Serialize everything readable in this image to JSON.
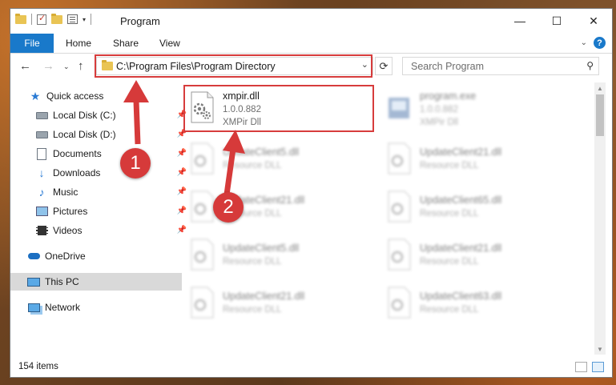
{
  "window": {
    "title": "Program",
    "minimize": "—",
    "maximize": "☐",
    "close": "✕"
  },
  "ribbon": {
    "tabs": [
      "File",
      "Home",
      "Share",
      "View"
    ],
    "help": "?"
  },
  "navbar": {
    "address": "C:\\Program Files\\Program Directory",
    "search_placeholder": "Search Program"
  },
  "sidebar": {
    "items": [
      {
        "label": "Quick access",
        "icon": "star-icon"
      },
      {
        "label": "Local Disk (C:)",
        "icon": "drive-icon"
      },
      {
        "label": "Local Disk (D:)",
        "icon": "drive-icon"
      },
      {
        "label": "Documents",
        "icon": "documents-icon"
      },
      {
        "label": "Downloads",
        "icon": "download-icon"
      },
      {
        "label": "Music",
        "icon": "music-icon"
      },
      {
        "label": "Pictures",
        "icon": "pictures-icon"
      },
      {
        "label": "Videos",
        "icon": "videos-icon"
      },
      {
        "label": "OneDrive",
        "icon": "cloud-icon"
      },
      {
        "label": "This PC",
        "icon": "computer-icon"
      },
      {
        "label": "Network",
        "icon": "network-icon"
      }
    ]
  },
  "files": [
    {
      "name": "xmpir.dll",
      "version": "1.0.0.882",
      "description": "XMPir Dll"
    },
    {
      "name": "program.exe",
      "version": "1.0.0.882",
      "description": "XMPir Dll"
    },
    {
      "name": "UpdateClient5.dll",
      "version": "",
      "description": "Resource DLL"
    },
    {
      "name": "UpdateClient21.dll",
      "version": "",
      "description": "Resource DLL"
    },
    {
      "name": "UpdateClient21.dll",
      "version": "",
      "description": "Resource DLL"
    },
    {
      "name": "UpdateClient65.dll",
      "version": "",
      "description": "Resource DLL"
    },
    {
      "name": "UpdateClient5.dll",
      "version": "",
      "description": "Resource DLL"
    },
    {
      "name": "UpdateClient21.dll",
      "version": "",
      "description": "Resource DLL"
    },
    {
      "name": "UpdateClient21.dll",
      "version": "",
      "description": "Resource DLL"
    },
    {
      "name": "UpdateClient63.dll",
      "version": "",
      "description": "Resource DLL"
    }
  ],
  "status": {
    "count": "154 items"
  },
  "annotations": {
    "marker1": "1",
    "marker2": "2",
    "color": "#d63a3a"
  }
}
